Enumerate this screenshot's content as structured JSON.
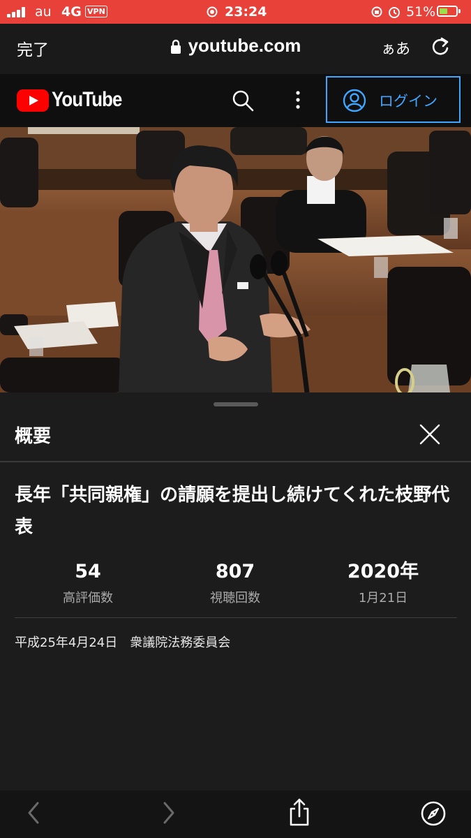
{
  "status_bar": {
    "carrier": "au",
    "network": "4G",
    "vpn": "VPN",
    "time": "23:24",
    "battery_percent": "51%",
    "battery_level": 0.51,
    "colors": {
      "background": "#e8413a",
      "battery_fill": "#9be04b"
    }
  },
  "browser": {
    "done_label": "完了",
    "url": "youtube.com",
    "text_size_label": "ぁあ",
    "icons": [
      "lock-icon",
      "reload-icon"
    ]
  },
  "youtube_header": {
    "logo_text": "YouTube",
    "login_label": "ログイン",
    "icons": [
      "youtube-logo-icon",
      "search-icon",
      "more-vertical-icon",
      "account-icon"
    ],
    "colors": {
      "brand_red": "#ff0000",
      "login_blue": "#3ea6ff"
    }
  },
  "description_panel": {
    "title": "概要",
    "video_title": "長年「共同親権」の請願を提出し続けてくれた枝野代表",
    "stats": [
      {
        "value": "54",
        "label": "高評価数"
      },
      {
        "value": "807",
        "label": "視聴回数"
      },
      {
        "value": "2020年",
        "label": "1月21日"
      }
    ],
    "description": "平成25年4月24日　衆議院法務委員会",
    "icons": [
      "close-icon"
    ]
  },
  "toolbar": {
    "icons": [
      "back-icon",
      "forward-icon",
      "share-icon",
      "compass-icon"
    ]
  }
}
